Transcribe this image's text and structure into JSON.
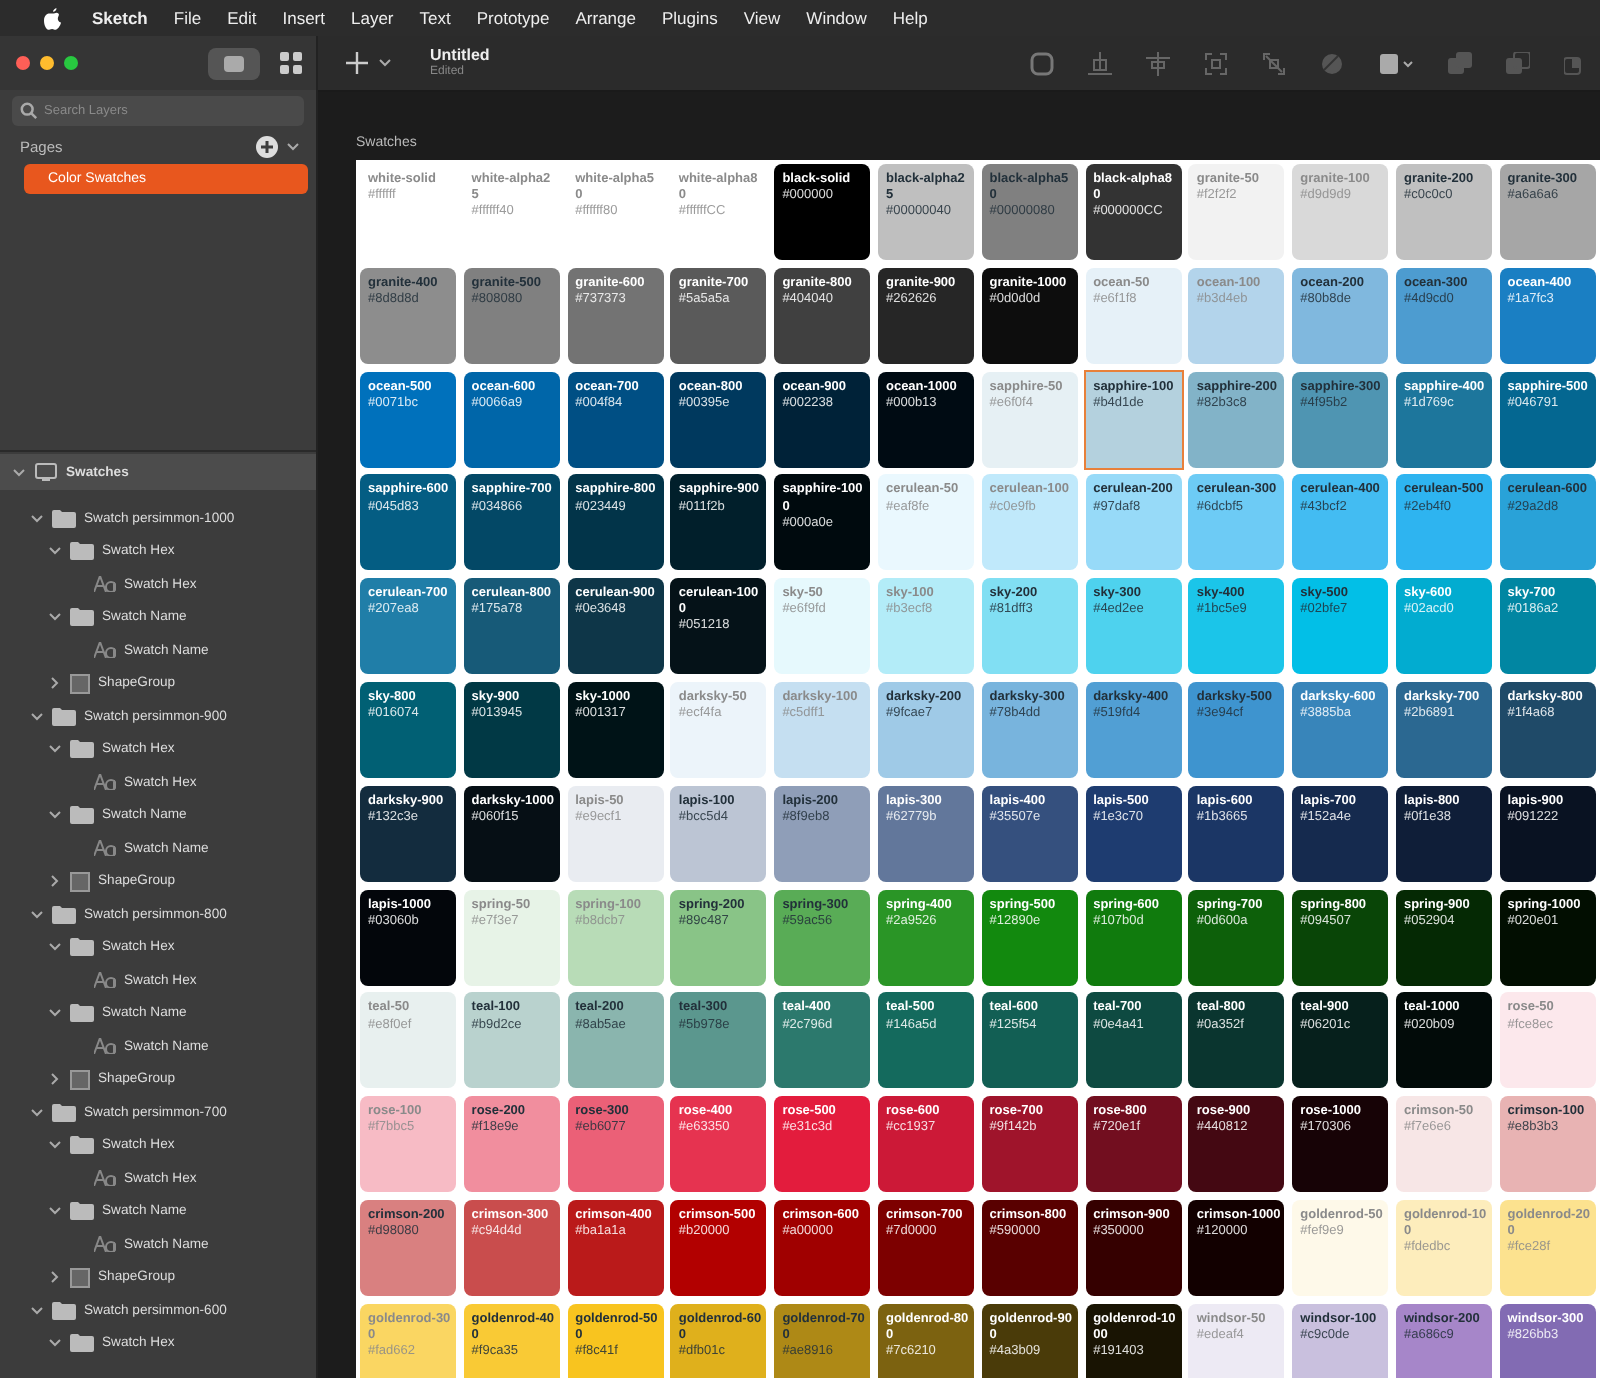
{
  "menu_bar": {
    "app": "Sketch",
    "items": [
      "File",
      "Edit",
      "Insert",
      "Layer",
      "Text",
      "Prototype",
      "Arrange",
      "Plugins",
      "View",
      "Window",
      "Help"
    ]
  },
  "document": {
    "title": "Untitled",
    "status": "Edited"
  },
  "sidebar": {
    "search": {
      "placeholder": "Search Layers"
    },
    "pages_heading": "Pages",
    "pages": [
      {
        "label": "Color Swatches",
        "selected": true
      }
    ],
    "layers": [
      {
        "label": "Swatches",
        "kind": "artboard",
        "expanded": true,
        "children": [
          {
            "label": "Swatch persimmon-1000",
            "kind": "group",
            "expanded": true,
            "children": [
              {
                "label": "Swatch Hex",
                "kind": "group",
                "expanded": true,
                "children": [
                  {
                    "label": "Swatch Hex",
                    "kind": "text"
                  }
                ]
              },
              {
                "label": "Swatch Name",
                "kind": "group",
                "expanded": true,
                "children": [
                  {
                    "label": "Swatch Name",
                    "kind": "text"
                  }
                ]
              },
              {
                "label": "ShapeGroup",
                "kind": "shape",
                "expanded": false
              }
            ]
          },
          {
            "label": "Swatch persimmon-900",
            "kind": "group",
            "expanded": true,
            "children": [
              {
                "label": "Swatch Hex",
                "kind": "group",
                "expanded": true,
                "children": [
                  {
                    "label": "Swatch Hex",
                    "kind": "text"
                  }
                ]
              },
              {
                "label": "Swatch Name",
                "kind": "group",
                "expanded": true,
                "children": [
                  {
                    "label": "Swatch Name",
                    "kind": "text"
                  }
                ]
              },
              {
                "label": "ShapeGroup",
                "kind": "shape",
                "expanded": false
              }
            ]
          },
          {
            "label": "Swatch persimmon-800",
            "kind": "group",
            "expanded": true,
            "children": [
              {
                "label": "Swatch Hex",
                "kind": "group",
                "expanded": true,
                "children": [
                  {
                    "label": "Swatch Hex",
                    "kind": "text"
                  }
                ]
              },
              {
                "label": "Swatch Name",
                "kind": "group",
                "expanded": true,
                "children": [
                  {
                    "label": "Swatch Name",
                    "kind": "text"
                  }
                ]
              },
              {
                "label": "ShapeGroup",
                "kind": "shape",
                "expanded": false
              }
            ]
          },
          {
            "label": "Swatch persimmon-700",
            "kind": "group",
            "expanded": true,
            "children": [
              {
                "label": "Swatch Hex",
                "kind": "group",
                "expanded": true,
                "children": [
                  {
                    "label": "Swatch Hex",
                    "kind": "text"
                  }
                ]
              },
              {
                "label": "Swatch Name",
                "kind": "group",
                "expanded": true,
                "children": [
                  {
                    "label": "Swatch Name",
                    "kind": "text"
                  }
                ]
              },
              {
                "label": "ShapeGroup",
                "kind": "shape",
                "expanded": false
              }
            ]
          },
          {
            "label": "Swatch persimmon-600",
            "kind": "group",
            "expanded": true,
            "children": [
              {
                "label": "Swatch Hex",
                "kind": "group",
                "expanded": true
              }
            ]
          }
        ]
      }
    ]
  },
  "artboard": {
    "title": "Swatches",
    "swatches": [
      {
        "name": "white-solid",
        "hex": "#ffffff",
        "color": "#ffffff",
        "selected": false
      },
      {
        "name": "white-alpha25",
        "hex": "#ffffff40",
        "color": "#ffffff",
        "selected": false
      },
      {
        "name": "white-alpha50",
        "hex": "#ffffff80",
        "color": "#ffffff",
        "selected": false
      },
      {
        "name": "white-alpha80",
        "hex": "#ffffffCC",
        "color": "#ffffff",
        "selected": false
      },
      {
        "name": "black-solid",
        "hex": "#000000",
        "color": "#000000",
        "selected": false
      },
      {
        "name": "black-alpha25",
        "hex": "#00000040",
        "color": "#bfbfbf",
        "selected": false
      },
      {
        "name": "black-alpha50",
        "hex": "#00000080",
        "color": "#808080",
        "selected": false
      },
      {
        "name": "black-alpha80",
        "hex": "#000000CC",
        "color": "#333333",
        "selected": false
      },
      {
        "name": "granite-50",
        "hex": "#f2f2f2",
        "color": "#f2f2f2",
        "selected": false
      },
      {
        "name": "granite-100",
        "hex": "#d9d9d9",
        "color": "#d9d9d9",
        "selected": false
      },
      {
        "name": "granite-200",
        "hex": "#c0c0c0",
        "color": "#c0c0c0",
        "selected": false
      },
      {
        "name": "granite-300",
        "hex": "#a6a6a6",
        "color": "#a6a6a6",
        "selected": false
      },
      {
        "name": "granite-400",
        "hex": "#8d8d8d",
        "color": "#8d8d8d",
        "selected": false
      },
      {
        "name": "granite-500",
        "hex": "#808080",
        "color": "#808080",
        "selected": false
      },
      {
        "name": "granite-600",
        "hex": "#737373",
        "color": "#737373",
        "selected": false
      },
      {
        "name": "granite-700",
        "hex": "#5a5a5a",
        "color": "#5a5a5a",
        "selected": false
      },
      {
        "name": "granite-800",
        "hex": "#404040",
        "color": "#404040",
        "selected": false
      },
      {
        "name": "granite-900",
        "hex": "#262626",
        "color": "#262626",
        "selected": false
      },
      {
        "name": "granite-1000",
        "hex": "#0d0d0d",
        "color": "#0d0d0d",
        "selected": false
      },
      {
        "name": "ocean-50",
        "hex": "#e6f1f8",
        "color": "#e6f1f8",
        "selected": false
      },
      {
        "name": "ocean-100",
        "hex": "#b3d4eb",
        "color": "#b3d4eb",
        "selected": false
      },
      {
        "name": "ocean-200",
        "hex": "#80b8de",
        "color": "#80b8de",
        "selected": false
      },
      {
        "name": "ocean-300",
        "hex": "#4d9cd0",
        "color": "#4d9cd0",
        "selected": false
      },
      {
        "name": "ocean-400",
        "hex": "#1a7fc3",
        "color": "#1a7fc3",
        "selected": false
      },
      {
        "name": "ocean-500",
        "hex": "#0071bc",
        "color": "#0071bc",
        "selected": false
      },
      {
        "name": "ocean-600",
        "hex": "#0066a9",
        "color": "#0066a9",
        "selected": false
      },
      {
        "name": "ocean-700",
        "hex": "#004f84",
        "color": "#004f84",
        "selected": false
      },
      {
        "name": "ocean-800",
        "hex": "#00395e",
        "color": "#00395e",
        "selected": false
      },
      {
        "name": "ocean-900",
        "hex": "#002238",
        "color": "#002238",
        "selected": false
      },
      {
        "name": "ocean-1000",
        "hex": "#000b13",
        "color": "#000b13",
        "selected": false
      },
      {
        "name": "sapphire-50",
        "hex": "#e6f0f4",
        "color": "#e6f0f4",
        "selected": false
      },
      {
        "name": "sapphire-100",
        "hex": "#b4d1de",
        "color": "#b4d1de",
        "selected": true
      },
      {
        "name": "sapphire-200",
        "hex": "#82b3c8",
        "color": "#82b3c8",
        "selected": false
      },
      {
        "name": "sapphire-300",
        "hex": "#4f95b2",
        "color": "#4f95b2",
        "selected": false
      },
      {
        "name": "sapphire-400",
        "hex": "#1d769c",
        "color": "#1d769c",
        "selected": false
      },
      {
        "name": "sapphire-500",
        "hex": "#046791",
        "color": "#046791",
        "selected": false
      },
      {
        "name": "sapphire-600",
        "hex": "#045d83",
        "color": "#045d83",
        "selected": false
      },
      {
        "name": "sapphire-700",
        "hex": "#034866",
        "color": "#034866",
        "selected": false
      },
      {
        "name": "sapphire-800",
        "hex": "#023449",
        "color": "#023449",
        "selected": false
      },
      {
        "name": "sapphire-900",
        "hex": "#011f2b",
        "color": "#011f2b",
        "selected": false
      },
      {
        "name": "sapphire-1000",
        "hex": "#000a0e",
        "color": "#000a0e",
        "selected": false
      },
      {
        "name": "cerulean-50",
        "hex": "#eaf8fe",
        "color": "#eaf8fe",
        "selected": false
      },
      {
        "name": "cerulean-100",
        "hex": "#c0e9fb",
        "color": "#c0e9fb",
        "selected": false
      },
      {
        "name": "cerulean-200",
        "hex": "#97daf8",
        "color": "#97daf8",
        "selected": false
      },
      {
        "name": "cerulean-300",
        "hex": "#6dcbf5",
        "color": "#6dcbf5",
        "selected": false
      },
      {
        "name": "cerulean-400",
        "hex": "#43bcf2",
        "color": "#43bcf2",
        "selected": false
      },
      {
        "name": "cerulean-500",
        "hex": "#2eb4f0",
        "color": "#2eb4f0",
        "selected": false
      },
      {
        "name": "cerulean-600",
        "hex": "#29a2d8",
        "color": "#29a2d8",
        "selected": false
      },
      {
        "name": "cerulean-700",
        "hex": "#207ea8",
        "color": "#207ea8",
        "selected": false
      },
      {
        "name": "cerulean-800",
        "hex": "#175a78",
        "color": "#175a78",
        "selected": false
      },
      {
        "name": "cerulean-900",
        "hex": "#0e3648",
        "color": "#0e3648",
        "selected": false
      },
      {
        "name": "cerulean-1000",
        "hex": "#051218",
        "color": "#051218",
        "selected": false
      },
      {
        "name": "sky-50",
        "hex": "#e6f9fd",
        "color": "#e6f9fd",
        "selected": false
      },
      {
        "name": "sky-100",
        "hex": "#b3ecf8",
        "color": "#b3ecf8",
        "selected": false
      },
      {
        "name": "sky-200",
        "hex": "#81dff3",
        "color": "#81dff3",
        "selected": false
      },
      {
        "name": "sky-300",
        "hex": "#4ed2ee",
        "color": "#4ed2ee",
        "selected": false
      },
      {
        "name": "sky-400",
        "hex": "#1bc5e9",
        "color": "#1bc5e9",
        "selected": false
      },
      {
        "name": "sky-500",
        "hex": "#02bfe7",
        "color": "#02bfe7",
        "selected": false
      },
      {
        "name": "sky-600",
        "hex": "#02acd0",
        "color": "#02acd0",
        "selected": false
      },
      {
        "name": "sky-700",
        "hex": "#0186a2",
        "color": "#0186a2",
        "selected": false
      },
      {
        "name": "sky-800",
        "hex": "#016074",
        "color": "#016074",
        "selected": false
      },
      {
        "name": "sky-900",
        "hex": "#013945",
        "color": "#013945",
        "selected": false
      },
      {
        "name": "sky-1000",
        "hex": "#001317",
        "color": "#001317",
        "selected": false
      },
      {
        "name": "darksky-50",
        "hex": "#ecf4fa",
        "color": "#ecf4fa",
        "selected": false
      },
      {
        "name": "darksky-100",
        "hex": "#c5dff1",
        "color": "#c5dff1",
        "selected": false
      },
      {
        "name": "darksky-200",
        "hex": "#9fcae7",
        "color": "#9fcae7",
        "selected": false
      },
      {
        "name": "darksky-300",
        "hex": "#78b4dd",
        "color": "#78b4dd",
        "selected": false
      },
      {
        "name": "darksky-400",
        "hex": "#519fd4",
        "color": "#519fd4",
        "selected": false
      },
      {
        "name": "darksky-500",
        "hex": "#3e94cf",
        "color": "#3e94cf",
        "selected": false
      },
      {
        "name": "darksky-600",
        "hex": "#3885ba",
        "color": "#3885ba",
        "selected": false
      },
      {
        "name": "darksky-700",
        "hex": "#2b6891",
        "color": "#2b6891",
        "selected": false
      },
      {
        "name": "darksky-800",
        "hex": "#1f4a68",
        "color": "#1f4a68",
        "selected": false
      },
      {
        "name": "darksky-900",
        "hex": "#132c3e",
        "color": "#132c3e",
        "selected": false
      },
      {
        "name": "darksky-1000",
        "hex": "#060f15",
        "color": "#060f15",
        "selected": false
      },
      {
        "name": "lapis-50",
        "hex": "#e9ecf1",
        "color": "#e9ecf1",
        "selected": false
      },
      {
        "name": "lapis-100",
        "hex": "#bcc5d4",
        "color": "#bcc5d4",
        "selected": false
      },
      {
        "name": "lapis-200",
        "hex": "#8f9eb8",
        "color": "#8f9eb8",
        "selected": false
      },
      {
        "name": "lapis-300",
        "hex": "#62779b",
        "color": "#62779b",
        "selected": false
      },
      {
        "name": "lapis-400",
        "hex": "#35507e",
        "color": "#35507e",
        "selected": false
      },
      {
        "name": "lapis-500",
        "hex": "#1e3c70",
        "color": "#1e3c70",
        "selected": false
      },
      {
        "name": "lapis-600",
        "hex": "#1b3665",
        "color": "#1b3665",
        "selected": false
      },
      {
        "name": "lapis-700",
        "hex": "#152a4e",
        "color": "#152a4e",
        "selected": false
      },
      {
        "name": "lapis-800",
        "hex": "#0f1e38",
        "color": "#0f1e38",
        "selected": false
      },
      {
        "name": "lapis-900",
        "hex": "#091222",
        "color": "#091222",
        "selected": false
      },
      {
        "name": "lapis-1000",
        "hex": "#03060b",
        "color": "#03060b",
        "selected": false
      },
      {
        "name": "spring-50",
        "hex": "#e7f3e7",
        "color": "#e7f3e7",
        "selected": false
      },
      {
        "name": "spring-100",
        "hex": "#b8dcb7",
        "color": "#b8dcb7",
        "selected": false
      },
      {
        "name": "spring-200",
        "hex": "#89c487",
        "color": "#89c487",
        "selected": false
      },
      {
        "name": "spring-300",
        "hex": "#59ac56",
        "color": "#59ac56",
        "selected": false
      },
      {
        "name": "spring-400",
        "hex": "#2a9526",
        "color": "#2a9526",
        "selected": false
      },
      {
        "name": "spring-500",
        "hex": "#12890e",
        "color": "#12890e",
        "selected": false
      },
      {
        "name": "spring-600",
        "hex": "#107b0d",
        "color": "#107b0d",
        "selected": false
      },
      {
        "name": "spring-700",
        "hex": "#0d600a",
        "color": "#0d600a",
        "selected": false
      },
      {
        "name": "spring-800",
        "hex": "#094507",
        "color": "#094507",
        "selected": false
      },
      {
        "name": "spring-900",
        "hex": "#052904",
        "color": "#052904",
        "selected": false
      },
      {
        "name": "spring-1000",
        "hex": "#020e01",
        "color": "#020e01",
        "selected": false
      },
      {
        "name": "teal-50",
        "hex": "#e8f0ef",
        "color": "#e8f0ef",
        "selected": false
      },
      {
        "name": "teal-100",
        "hex": "#b9d2ce",
        "color": "#b9d2ce",
        "selected": false
      },
      {
        "name": "teal-200",
        "hex": "#8ab5ae",
        "color": "#8ab5ae",
        "selected": false
      },
      {
        "name": "teal-300",
        "hex": "#5b978e",
        "color": "#5b978e",
        "selected": false
      },
      {
        "name": "teal-400",
        "hex": "#2c796d",
        "color": "#2c796d",
        "selected": false
      },
      {
        "name": "teal-500",
        "hex": "#146a5d",
        "color": "#146a5d",
        "selected": false
      },
      {
        "name": "teal-600",
        "hex": "#125f54",
        "color": "#125f54",
        "selected": false
      },
      {
        "name": "teal-700",
        "hex": "#0e4a41",
        "color": "#0e4a41",
        "selected": false
      },
      {
        "name": "teal-800",
        "hex": "#0a352f",
        "color": "#0a352f",
        "selected": false
      },
      {
        "name": "teal-900",
        "hex": "#06201c",
        "color": "#06201c",
        "selected": false
      },
      {
        "name": "teal-1000",
        "hex": "#020b09",
        "color": "#020b09",
        "selected": false
      },
      {
        "name": "rose-50",
        "hex": "#fce8ec",
        "color": "#fce8ec",
        "selected": false
      },
      {
        "name": "rose-100",
        "hex": "#f7bbc5",
        "color": "#f7bbc5",
        "selected": false
      },
      {
        "name": "rose-200",
        "hex": "#f18e9e",
        "color": "#f18e9e",
        "selected": false
      },
      {
        "name": "rose-300",
        "hex": "#eb6077",
        "color": "#eb6077",
        "selected": false
      },
      {
        "name": "rose-400",
        "hex": "#e63350",
        "color": "#e63350",
        "selected": false
      },
      {
        "name": "rose-500",
        "hex": "#e31c3d",
        "color": "#e31c3d",
        "selected": false
      },
      {
        "name": "rose-600",
        "hex": "#cc1937",
        "color": "#cc1937",
        "selected": false
      },
      {
        "name": "rose-700",
        "hex": "#9f142b",
        "color": "#9f142b",
        "selected": false
      },
      {
        "name": "rose-800",
        "hex": "#720e1f",
        "color": "#720e1f",
        "selected": false
      },
      {
        "name": "rose-900",
        "hex": "#440812",
        "color": "#440812",
        "selected": false
      },
      {
        "name": "rose-1000",
        "hex": "#170306",
        "color": "#170306",
        "selected": false
      },
      {
        "name": "crimson-50",
        "hex": "#f7e6e6",
        "color": "#f7e6e6",
        "selected": false
      },
      {
        "name": "crimson-100",
        "hex": "#e8b3b3",
        "color": "#e8b3b3",
        "selected": false
      },
      {
        "name": "crimson-200",
        "hex": "#d98080",
        "color": "#d98080",
        "selected": false
      },
      {
        "name": "crimson-300",
        "hex": "#c94d4d",
        "color": "#c94d4d",
        "selected": false
      },
      {
        "name": "crimson-400",
        "hex": "#ba1a1a",
        "color": "#ba1a1a",
        "selected": false
      },
      {
        "name": "crimson-500",
        "hex": "#b20000",
        "color": "#b20000",
        "selected": false
      },
      {
        "name": "crimson-600",
        "hex": "#a00000",
        "color": "#a00000",
        "selected": false
      },
      {
        "name": "crimson-700",
        "hex": "#7d0000",
        "color": "#7d0000",
        "selected": false
      },
      {
        "name": "crimson-800",
        "hex": "#590000",
        "color": "#590000",
        "selected": false
      },
      {
        "name": "crimson-900",
        "hex": "#350000",
        "color": "#350000",
        "selected": false
      },
      {
        "name": "crimson-1000",
        "hex": "#120000",
        "color": "#120000",
        "selected": false
      },
      {
        "name": "goldenrod-50",
        "hex": "#fef9e9",
        "color": "#fef9e9",
        "selected": false
      },
      {
        "name": "goldenrod-100",
        "hex": "#fdedbc",
        "color": "#fdedbc",
        "selected": false
      },
      {
        "name": "goldenrod-200",
        "hex": "#fce28f",
        "color": "#fce28f",
        "selected": false
      },
      {
        "name": "goldenrod-300",
        "hex": "#fad662",
        "color": "#fad662",
        "selected": false
      },
      {
        "name": "goldenrod-400",
        "hex": "#f9ca35",
        "color": "#f9ca35",
        "selected": false
      },
      {
        "name": "goldenrod-500",
        "hex": "#f8c41f",
        "color": "#f8c41f",
        "selected": false
      },
      {
        "name": "goldenrod-600",
        "hex": "#dfb01c",
        "color": "#dfb01c",
        "selected": false
      },
      {
        "name": "goldenrod-700",
        "hex": "#ae8916",
        "color": "#ae8916",
        "selected": false
      },
      {
        "name": "goldenrod-800",
        "hex": "#7c6210",
        "color": "#7c6210",
        "selected": false
      },
      {
        "name": "goldenrod-900",
        "hex": "#4a3b09",
        "color": "#4a3b09",
        "selected": false
      },
      {
        "name": "goldenrod-1000",
        "hex": "#191403",
        "color": "#191403",
        "selected": false
      },
      {
        "name": "windsor-50",
        "hex": "#edeaf4",
        "color": "#edeaf4",
        "selected": false
      },
      {
        "name": "windsor-100",
        "hex": "#c9c0de",
        "color": "#c9c0de",
        "selected": false
      },
      {
        "name": "windsor-200",
        "hex": "#a686c9",
        "color": "#a686c9",
        "selected": false
      },
      {
        "name": "windsor-300",
        "hex": "#826bb3",
        "color": "#826bb3",
        "selected": false
      }
    ]
  }
}
